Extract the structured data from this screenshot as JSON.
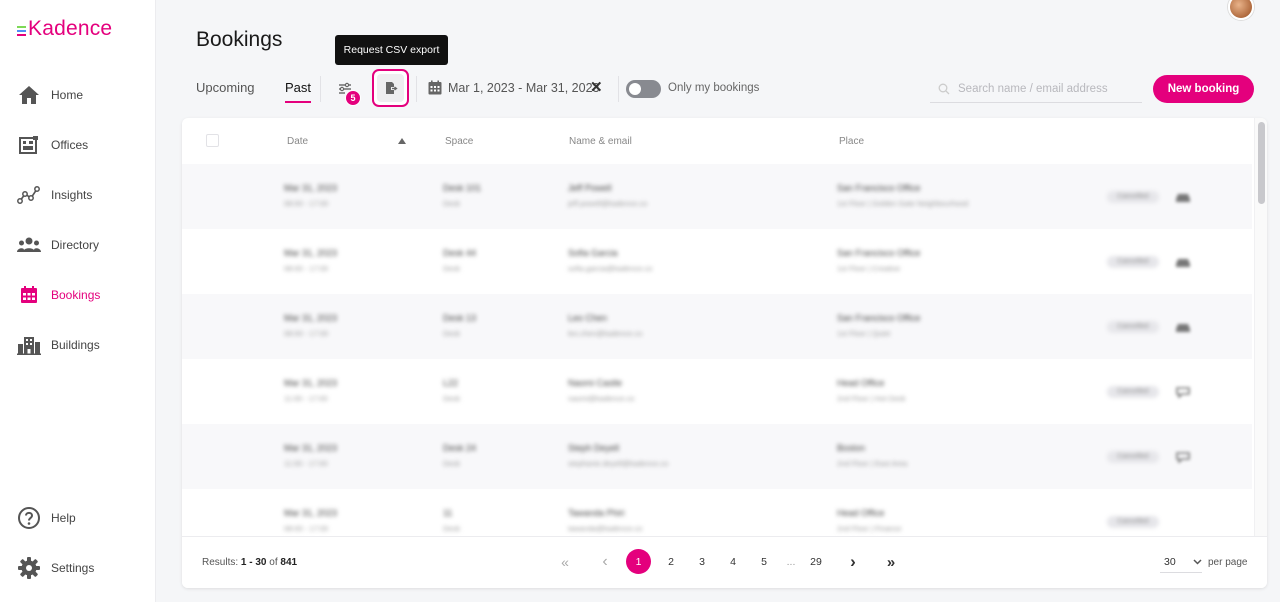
{
  "app": {
    "logo_text": "Kadence",
    "logo_bar_colors": [
      "#7ed957",
      "#4f8ef7",
      "#e4007d"
    ],
    "accent": "#e4007d"
  },
  "sidebar": {
    "items": [
      {
        "label": "Home",
        "icon": "home-icon"
      },
      {
        "label": "Offices",
        "icon": "office-icon"
      },
      {
        "label": "Insights",
        "icon": "insights-icon"
      },
      {
        "label": "Directory",
        "icon": "people-icon"
      },
      {
        "label": "Bookings",
        "icon": "calendar-icon",
        "active": true
      },
      {
        "label": "Buildings",
        "icon": "building-icon"
      }
    ],
    "bottom_items": [
      {
        "label": "Help",
        "icon": "help-icon"
      },
      {
        "label": "Settings",
        "icon": "gear-icon"
      }
    ]
  },
  "header": {
    "title": "Bookings",
    "tabs": [
      {
        "label": "Upcoming"
      },
      {
        "label": "Past",
        "active": true
      }
    ],
    "filter_count": "5",
    "export_tooltip": "Request CSV export",
    "date_range": "Mar 1, 2023 - Mar 31, 2023",
    "date_clear": "✕",
    "toggle_label": "Only my bookings",
    "toggle_on": false,
    "search_placeholder": "Search name / email address",
    "new_booking_label": "New booking"
  },
  "table": {
    "columns": {
      "date": "Date",
      "space": "Space",
      "name_email": "Name & email",
      "place": "Place"
    },
    "sort": "date-ascending",
    "rows": [
      {
        "date": "Mar 31, 2023",
        "time": "08:00 - 17:00",
        "space": "Desk 101",
        "space_type": "Desk",
        "name": "Jeff Powell",
        "email": "jeff.powell@kadence.co",
        "place": "San Francisco Office",
        "place_detail": "1st Floor | Golden Gate Neighbourhood",
        "status": "Cancelled",
        "icon": "car-icon"
      },
      {
        "date": "Mar 31, 2023",
        "time": "08:00 - 17:00",
        "space": "Desk 44",
        "space_type": "Desk",
        "name": "Sofia Garcia",
        "email": "sofia.garcia@kadence.co",
        "place": "San Francisco Office",
        "place_detail": "1st Floor | Creative",
        "status": "Cancelled",
        "icon": "car-icon"
      },
      {
        "date": "Mar 31, 2023",
        "time": "08:00 - 17:00",
        "space": "Desk 13",
        "space_type": "Desk",
        "name": "Leo Chen",
        "email": "leo.chen@kadence.co",
        "place": "San Francisco Office",
        "place_detail": "1st Floor | Quiet",
        "status": "Cancelled",
        "icon": "car-icon"
      },
      {
        "date": "Mar 31, 2023",
        "time": "11:00 - 17:00",
        "space": "L22",
        "space_type": "Desk",
        "name": "Naomi Castle",
        "email": "naomi@kadence.co",
        "place": "Head Office",
        "place_detail": "2nd Floor | Hot Desk",
        "status": "Cancelled",
        "icon": "chat-icon"
      },
      {
        "date": "Mar 31, 2023",
        "time": "11:00 - 17:00",
        "space": "Desk 24",
        "space_type": "Desk",
        "name": "Steph Deyell",
        "email": "stephanie.deyell@kadence.co",
        "place": "Boston",
        "place_detail": "2nd Floor | East Area",
        "status": "Cancelled",
        "icon": "chat-icon"
      },
      {
        "date": "Mar 31, 2023",
        "time": "08:00 - 17:00",
        "space": "11",
        "space_type": "Desk",
        "name": "Tawanda Phiri",
        "email": "tawanda@kadence.co",
        "place": "Head Office",
        "place_detail": "2nd Floor | Finance",
        "status": "Cancelled",
        "icon": ""
      }
    ]
  },
  "pagination": {
    "results_prefix": "Results:",
    "results_range": "1 - 30",
    "results_of": "of",
    "results_total": "841",
    "first": "«",
    "prev": "‹",
    "pages": [
      "1",
      "2",
      "3",
      "4",
      "5"
    ],
    "ellipsis": "...",
    "last_page": "29",
    "next": "›",
    "last": "»",
    "current_page": "1",
    "per_page_value": "30",
    "per_page_label": "per page"
  }
}
